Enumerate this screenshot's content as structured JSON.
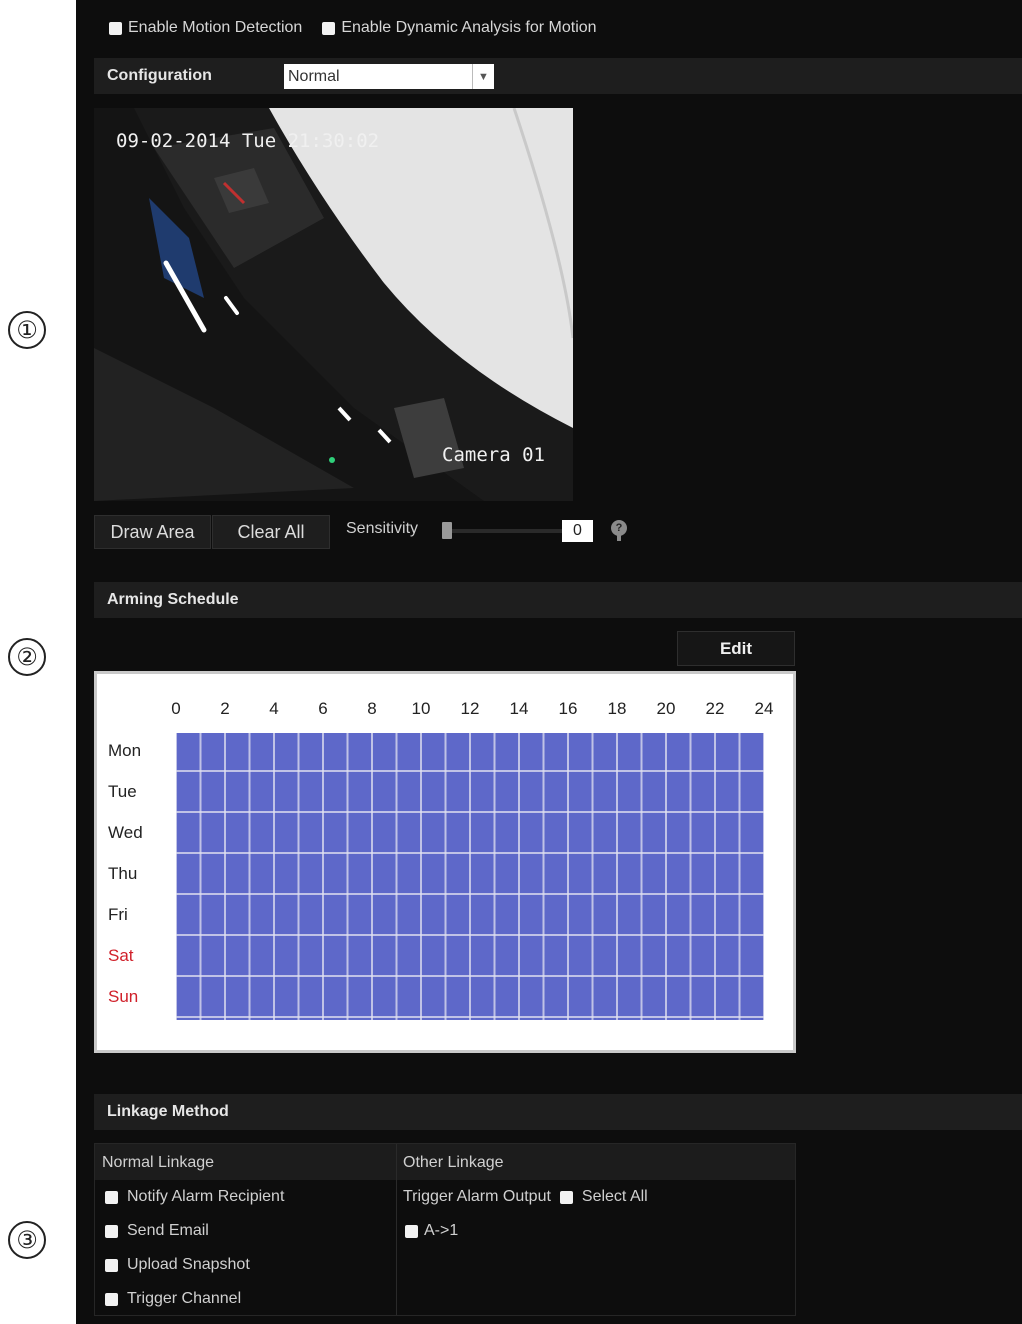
{
  "callouts": [
    "①",
    "②",
    "③"
  ],
  "top_options": {
    "enable_motion": "Enable Motion Detection",
    "enable_dynamic": "Enable Dynamic Analysis for Motion"
  },
  "configuration": {
    "label": "Configuration",
    "value": "Normal"
  },
  "video": {
    "timestamp": "09-02-2014 Tue 21:30:02",
    "camera_name": "Camera 01"
  },
  "area_buttons": {
    "draw_area": "Draw Area",
    "clear_all": "Clear All"
  },
  "sensitivity": {
    "label": "Sensitivity",
    "value": "0",
    "level": 0
  },
  "arming_schedule": {
    "title": "Arming Schedule",
    "edit_label": "Edit",
    "hours": [
      "0",
      "2",
      "4",
      "6",
      "8",
      "10",
      "12",
      "14",
      "16",
      "18",
      "20",
      "22",
      "24"
    ],
    "days": [
      "Mon",
      "Tue",
      "Wed",
      "Thu",
      "Fri",
      "Sat",
      "Sun"
    ],
    "weekend_color": "#d0202a",
    "fill_color": "#5e68c9"
  },
  "linkage": {
    "title": "Linkage Method",
    "normal_title": "Normal Linkage",
    "other_title": "Other Linkage",
    "normal_items": [
      "Notify Alarm Recipient",
      "Send Email",
      "Upload Snapshot",
      "Trigger Channel"
    ],
    "trigger_alarm_output": "Trigger Alarm Output",
    "select_all": "Select All",
    "alarm_output_item": "A->1"
  }
}
